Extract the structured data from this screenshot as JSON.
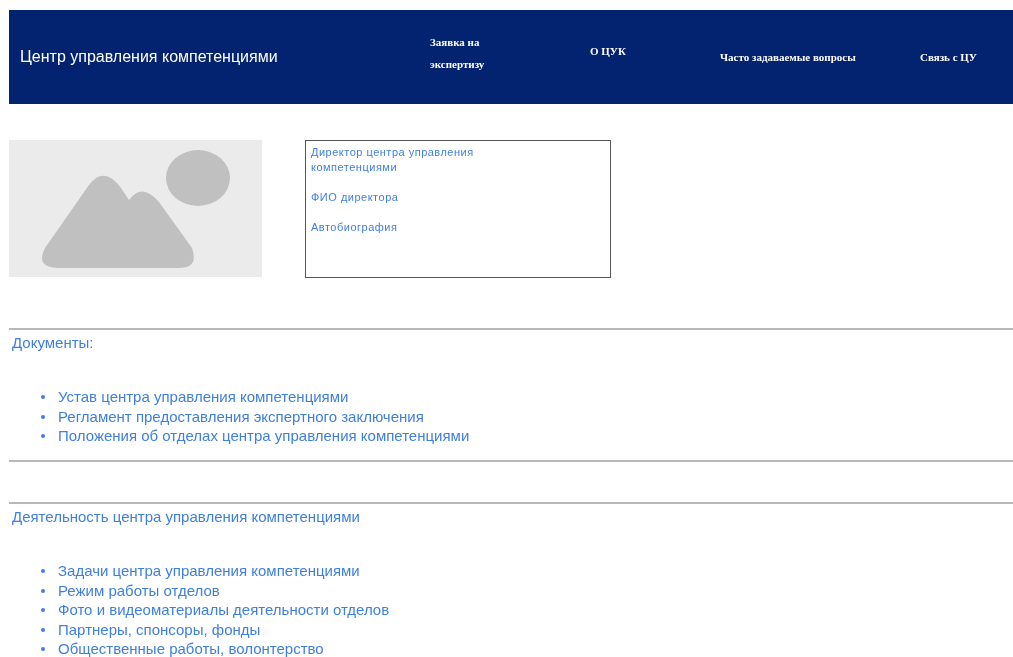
{
  "header": {
    "title": "Центр управления компетенциями",
    "nav": [
      {
        "label": "Заявка на экспертизу"
      },
      {
        "label": "О ЦУК"
      },
      {
        "label": "Часто задаваемые вопросы"
      },
      {
        "label": "Связь с ЦУ"
      }
    ]
  },
  "director_card": {
    "lines": [
      "Директор центра управления компетенциями",
      "ФИО директора",
      "Автобиография"
    ]
  },
  "sections": [
    {
      "heading": "Документы:",
      "links": [
        "Устав центра управления компетенциями",
        "Регламент предоставления экспертного заключения",
        "Положения об отделах центра управления компетенциями"
      ]
    },
    {
      "heading": "Деятельность центра управления компетенциями",
      "links": [
        "Задачи центра управления компетенциями",
        "Режим работы отделов",
        "Фото и видеоматериалы деятельности отделов",
        "Партнеры, спонсоры, фонды",
        "Общественные работы, волонтерство"
      ]
    }
  ]
}
